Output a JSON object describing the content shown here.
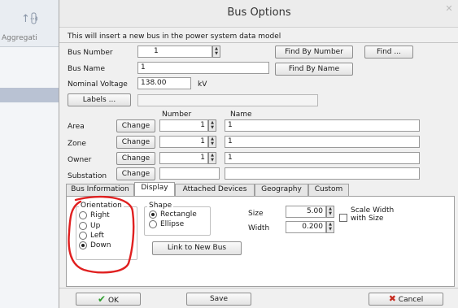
{
  "background_app": {
    "label": "Aggregati",
    "icon": "aggregation-icon"
  },
  "dialog": {
    "title": "Bus Options",
    "info_text": "This will insert a new bus in the power system data model",
    "bus_number": {
      "label": "Bus Number",
      "value": "1",
      "find_by_number": "Find By Number",
      "find": "Find ..."
    },
    "bus_name": {
      "label": "Bus Name",
      "value": "1",
      "find_by_name": "Find By Name"
    },
    "nominal_voltage": {
      "label": "Nominal Voltage",
      "value": "138.00",
      "unit": "kV"
    },
    "labels_button": "Labels ...",
    "grid": {
      "col_number": "Number",
      "col_name": "Name",
      "change_label": "Change",
      "rows": [
        {
          "label": "Area",
          "number": "1",
          "name": "1"
        },
        {
          "label": "Zone",
          "number": "1",
          "name": "1"
        },
        {
          "label": "Owner",
          "number": "1",
          "name": "1"
        },
        {
          "label": "Substation",
          "number": "",
          "name": ""
        }
      ]
    },
    "tabs": [
      "Bus Information",
      "Display",
      "Attached Devices",
      "Geography",
      "Custom"
    ],
    "active_tab": "Display",
    "display": {
      "orientation_title": "Orientation",
      "orientation_options": [
        "Right",
        "Up",
        "Left",
        "Down"
      ],
      "orientation_selected": "Down",
      "shape_title": "Shape",
      "shape_options": [
        "Rectangle",
        "Ellipse"
      ],
      "shape_selected": "Rectangle",
      "size_label": "Size",
      "size_value": "5.00",
      "width_label": "Width",
      "width_value": "0.200",
      "scale_width_label": "Scale Width with Size",
      "link_button": "Link to New Bus"
    },
    "footer": {
      "ok": "OK",
      "save": "Save",
      "cancel": "Cancel"
    }
  },
  "annotation": {
    "color": "#e02020"
  },
  "colors": {
    "dialog_bg": "#f0f0f0",
    "ok_check": "#2e9d2e",
    "cancel_x": "#c62a1e"
  }
}
